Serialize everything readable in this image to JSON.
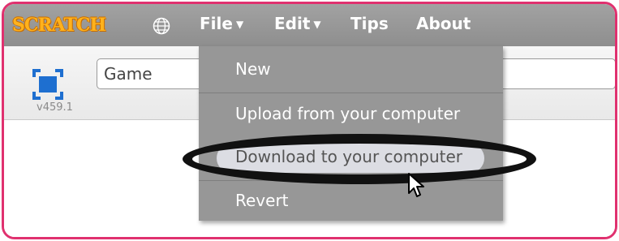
{
  "app": {
    "logo_text": "SCRATCH",
    "version": "v459.1"
  },
  "menubar": {
    "globe_icon": "globe-icon",
    "file": "File",
    "edit": "Edit",
    "tips": "Tips",
    "about": "About"
  },
  "project": {
    "title_value": "Game"
  },
  "file_menu": {
    "items": [
      "New",
      "Upload from your computer",
      "Download to your computer",
      "Revert"
    ],
    "highlighted": "Download to your computer"
  },
  "colors": {
    "frame_border": "#e0316f",
    "menubar": "#999999",
    "dropdown": "#979797",
    "highlight": "#dcdde3",
    "logo": "#ffb21c",
    "fullscreen_icon": "#1e6fd0"
  }
}
